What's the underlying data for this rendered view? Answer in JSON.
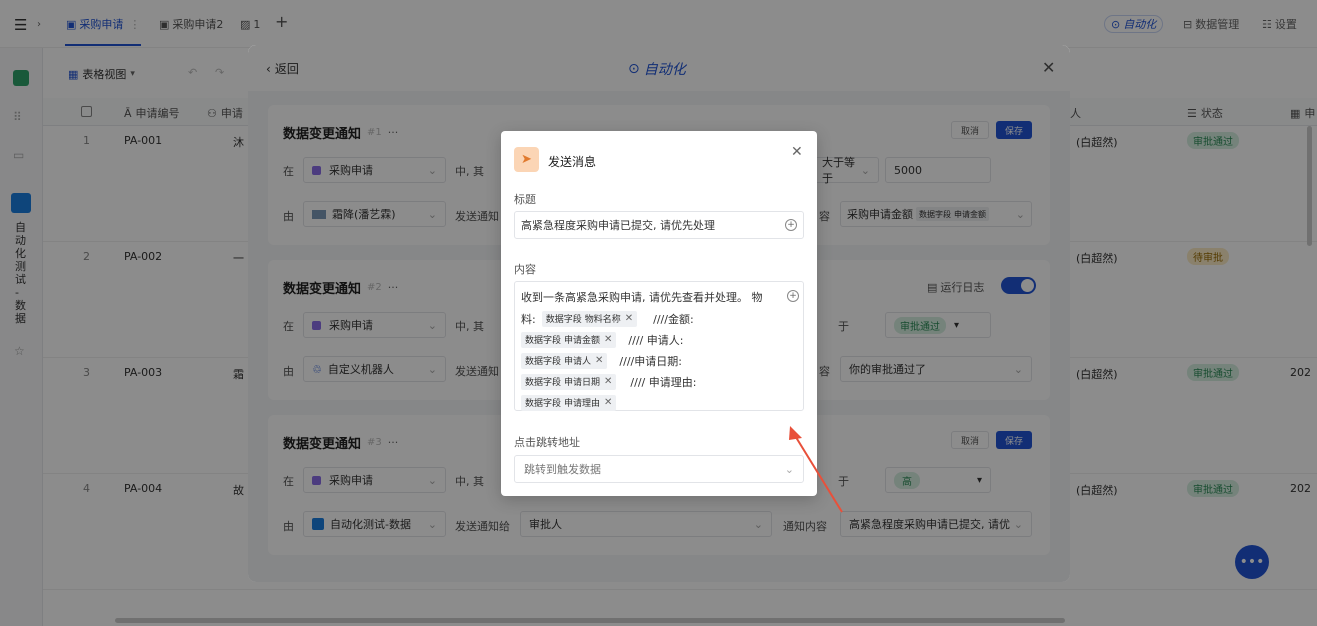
{
  "topbar": {
    "tabs": [
      {
        "label": "采购申请",
        "icon": "document-icon"
      },
      {
        "label": "采购申请2",
        "icon": "document-icon"
      },
      {
        "label": "1",
        "icon": "image-icon"
      }
    ],
    "add_tab": "+",
    "right_buttons": [
      "自动化",
      "数据管理",
      "设置"
    ]
  },
  "sidebar": {
    "vertical_label": [
      "自",
      "动",
      "化",
      "测",
      "试",
      "-",
      "数",
      "据"
    ]
  },
  "toolbar": {
    "view_label": "表格视图"
  },
  "table": {
    "headers": [
      "申请编号",
      "申请",
      "状态",
      "申"
    ],
    "rows": [
      {
        "num": "1",
        "code": "PA-001",
        "name": "沐",
        "person": "(白超然)",
        "status": "审批通过",
        "date": ""
      },
      {
        "num": "2",
        "code": "PA-002",
        "name": "一",
        "person": "(白超然)",
        "status": "待审批",
        "date": ""
      },
      {
        "num": "3",
        "code": "PA-003",
        "name": "霜",
        "person": "(白超然)",
        "status": "审批通过",
        "date": "202"
      },
      {
        "num": "4",
        "code": "PA-004",
        "name": "故",
        "person": "(白超然)",
        "status": "审批通过",
        "date": "202"
      }
    ],
    "header_right_label": "人"
  },
  "automation": {
    "back_label": "返回",
    "title": "自动化",
    "cards": [
      {
        "title": "数据变更通知",
        "index": "#1",
        "in_label": "在",
        "in_value": "采购申请",
        "mid_label": "中, 其",
        "cond_op": "大于等于",
        "cond_value": "5000",
        "by_label": "由",
        "by_value": "霜降(潘艺霖)",
        "send_label": "发送通知",
        "content_label": "容",
        "content_value": "采购申请金额",
        "chip_a": "数据字段",
        "chip_b": "申请金额",
        "cancel": "取消",
        "save": "保存"
      },
      {
        "title": "数据变更通知",
        "index": "#2",
        "in_label": "在",
        "in_value": "采购申请",
        "mid_label": "中, 其",
        "cond_op": "于",
        "cond_value": "审批通过",
        "by_label": "由",
        "by_value": "自定义机器人",
        "send_label": "发送通知",
        "content_label": "容",
        "content_value": "你的审批通过了",
        "log_label": "运行日志"
      },
      {
        "title": "数据变更通知",
        "index": "#3",
        "in_label": "在",
        "in_value": "采购申请",
        "mid_label": "中, 其",
        "cond_op": "于",
        "cond_value": "高",
        "by_label": "由",
        "by_value": "自动化测试-数据",
        "send_label": "发送通知给",
        "to_value": "审批人",
        "content_label": "通知内容",
        "content_value": "高紧急程度采购申请已提交, 请优",
        "cancel": "取消",
        "save": "保存"
      }
    ]
  },
  "modal": {
    "title": "发送消息",
    "subject_label": "标题",
    "subject_value": "高紧急程度采购申请已提交, 请优先处理",
    "content_label": "内容",
    "content_line1": "收到一条高紧急采购申请, 请优先查看并处理。 物",
    "content_line2_prefix": "料:",
    "content_t1": "////金额:",
    "content_t2": "//// 申请人:",
    "content_t3": "////申请日期:",
    "content_t4": "//// 申请理由:",
    "chip_prefix": "数据字段",
    "chips": [
      "物料名称",
      "申请金额",
      "申请人",
      "申请日期",
      "申请理由"
    ],
    "url_label": "点击跳转地址",
    "url_placeholder": "跳转到触发数据"
  },
  "colors": {
    "accent": "#2155d6",
    "arrow": "#e8503a",
    "overlay": "rgba(0,0,0,0.45)"
  }
}
